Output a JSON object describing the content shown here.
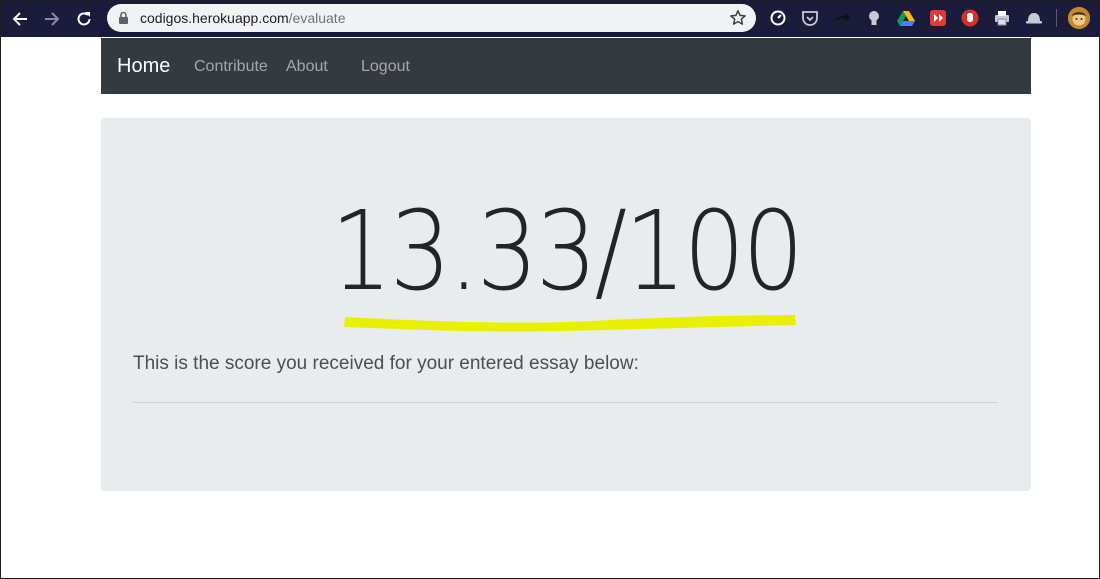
{
  "browser": {
    "url_host": "codigos.herokuapp.com",
    "url_path": "/evaluate",
    "extensions": [
      "speedometer-icon",
      "pocket-icon",
      "share-arrow-icon",
      "bulb-icon",
      "google-drive-icon",
      "youtube-download-icon",
      "hand-stop-icon",
      "printer-icon",
      "hat-icon"
    ],
    "colors": {
      "chrome_bg": "#1b1b3c",
      "omnibox_bg": "#f1f3f4"
    }
  },
  "navbar": {
    "brand": "Home",
    "links": [
      "Contribute",
      "About",
      "Logout"
    ]
  },
  "result": {
    "score": "13.33/100",
    "message": "This is the score you received for your entered essay below:",
    "highlight_color": "#e8f000"
  }
}
